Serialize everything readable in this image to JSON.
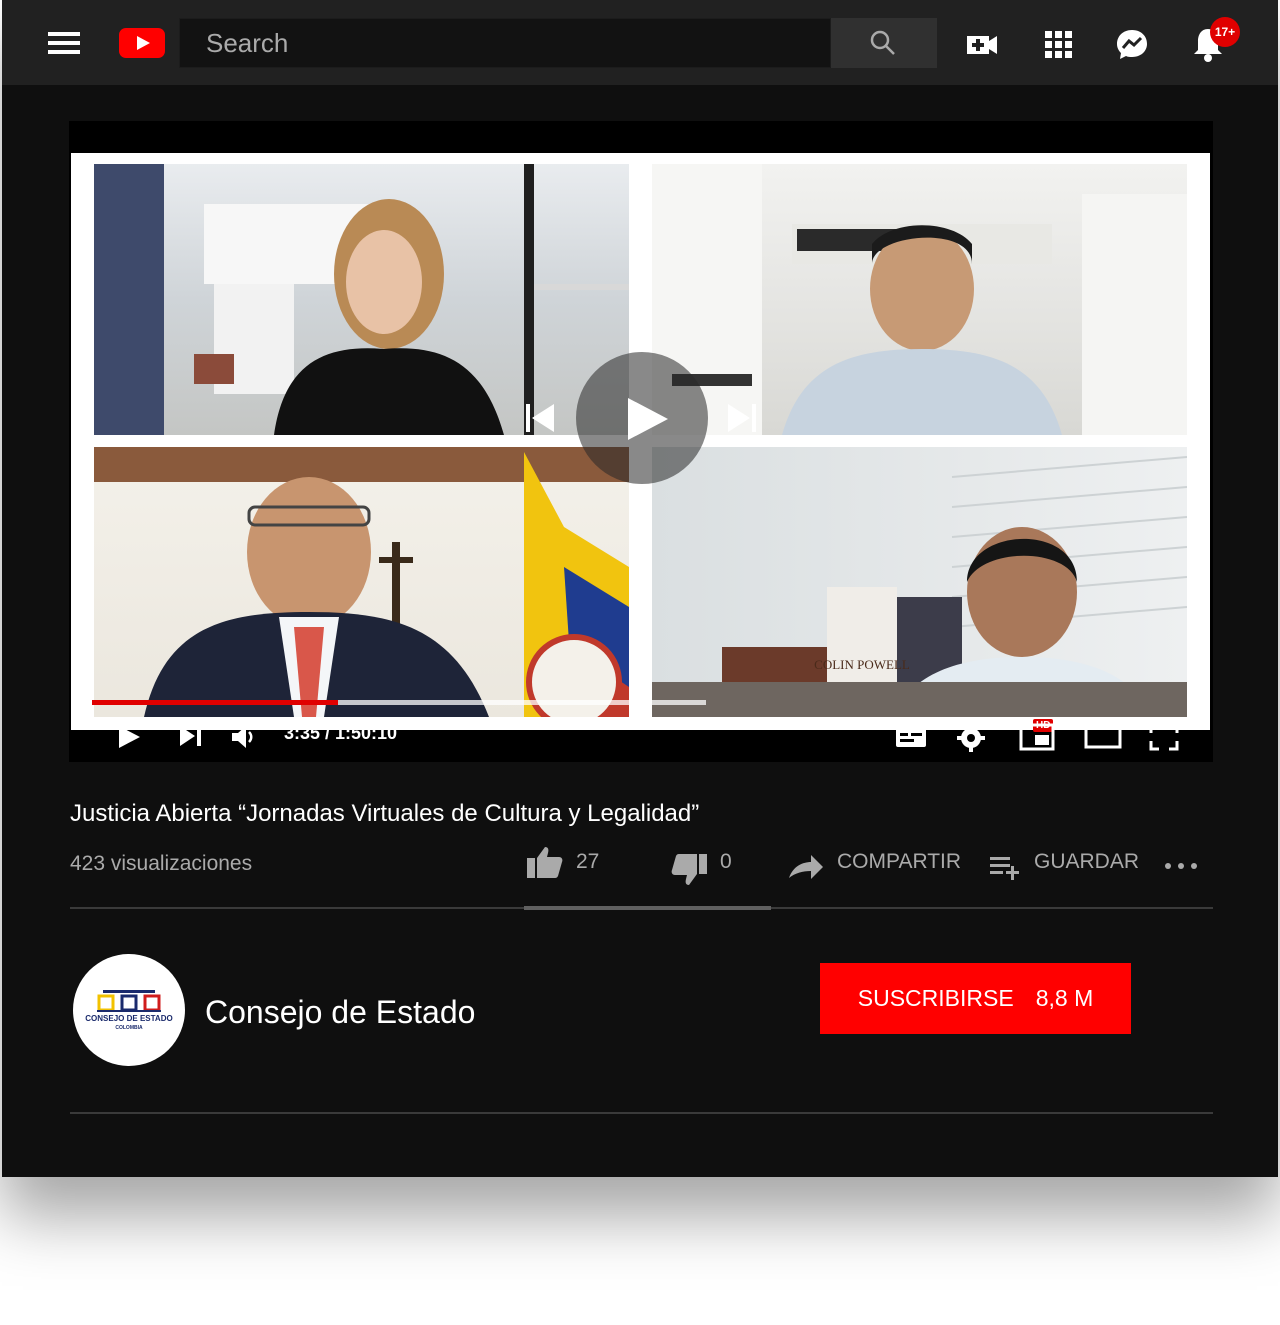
{
  "header": {
    "search_placeholder": "Search",
    "notifications_badge": "17+"
  },
  "player": {
    "time": "3:35 / 1:50:10",
    "progress_fraction": 0.4,
    "quality_badge": "HD",
    "book_text": "COLIN POWELL"
  },
  "video": {
    "title": "Justicia Abierta “Jornadas Virtuales de Cultura y Legalidad”",
    "views": "423 visualizaciones",
    "likes": "27",
    "dislikes": "0",
    "share_label": "COMPARTIR",
    "save_label": "GUARDAR"
  },
  "channel": {
    "name": "Consejo de Estado",
    "logo_text": "CONSEJO DE ESTADO",
    "logo_subtext": "COLOMBIA",
    "subscribe_label": "SUSCRIBIRSE",
    "subscriber_count": "8,8 M"
  },
  "colors": {
    "brand_red": "#ff0000",
    "background": "#0f0f0f",
    "topbar": "#212121"
  }
}
